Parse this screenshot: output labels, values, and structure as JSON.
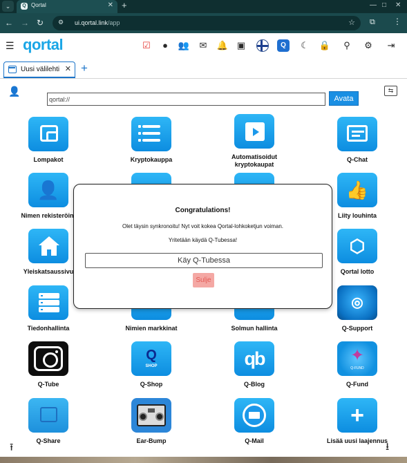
{
  "browser": {
    "tab_title": "Qortal",
    "favicon_letter": "Q",
    "url_host": "ui.qortal.link",
    "url_path": "/app"
  },
  "header": {
    "logo": "qortal"
  },
  "tabs": {
    "active_label": "Uusi välilehti"
  },
  "address": {
    "value": "qortal://",
    "open_label": "Avata"
  },
  "apps": [
    {
      "label": "Lompakot"
    },
    {
      "label": "Kryptokauppa"
    },
    {
      "label": "Automatisoidut kryptokaupat"
    },
    {
      "label": "Q-Chat"
    },
    {
      "label": "Nimen rekisteröint"
    },
    {
      "label": "Liity louhinta"
    },
    {
      "label": "Yleiskatsaussivu"
    },
    {
      "label": "Qortal lotto"
    },
    {
      "label": "Tiedonhallinta"
    },
    {
      "label": "Nimien markkinat"
    },
    {
      "label": "Solmun hallinta"
    },
    {
      "label": "Q-Support"
    },
    {
      "label": "Q-Tube"
    },
    {
      "label": "Q-Shop"
    },
    {
      "label": "Q-Blog"
    },
    {
      "label": "Q-Fund"
    },
    {
      "label": "Q-Share"
    },
    {
      "label": "Ear-Bump"
    },
    {
      "label": "Q-Mail"
    },
    {
      "label": "Lisää uusi laajennus"
    }
  ],
  "tile_text": {
    "qshop": "SHOP",
    "qfund": "Q-FUND",
    "qblog": "qb",
    "add": "+"
  },
  "dialog": {
    "title": "Congratulations!",
    "line1": "Olet täysin synkronoitu! Nyt voit kokea Qortal-lohkoketjun voiman.",
    "line2": "Yritetään käydä Q-Tubessa!",
    "go_label": "Käy Q-Tubessa",
    "close_label": "Sulje"
  },
  "colors": {
    "accent": "#1a8fe3",
    "tile": "#1b98ea",
    "close_button": "#f4a8a4"
  }
}
